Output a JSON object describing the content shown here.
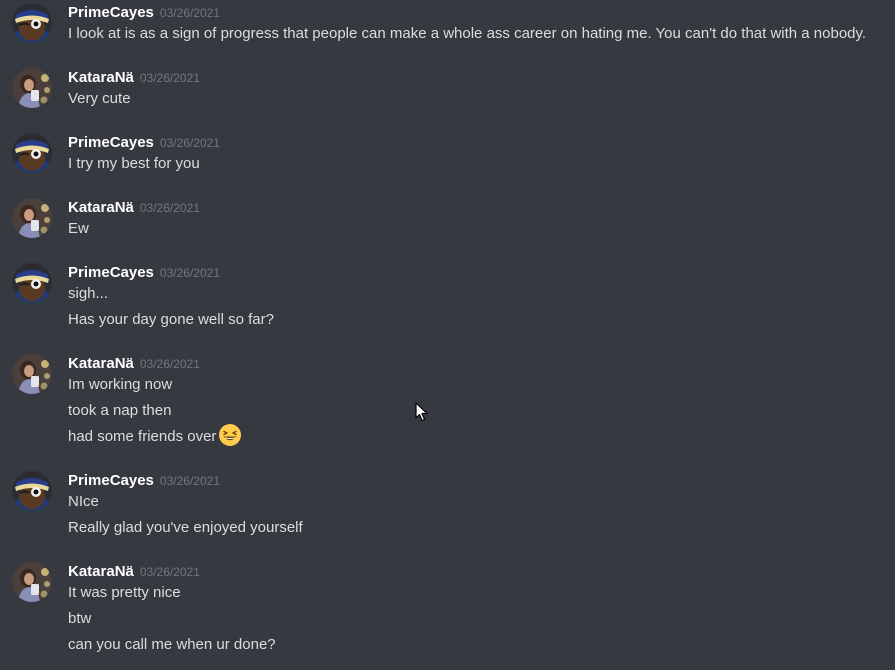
{
  "colors": {
    "background": "#36393f",
    "username": "#ffffff",
    "timestamp": "#72767d",
    "message_text": "#dcddde"
  },
  "messages": [
    {
      "author": "PrimeCayes",
      "timestamp": "03/26/2021",
      "avatar_icon": "prime-cayes-avatar-icon",
      "lines": [
        "I look at is as a sign of progress that people can make a whole ass career on hating me. You can't do that with a nobody."
      ]
    },
    {
      "author": "KataraNä",
      "timestamp": "03/26/2021",
      "avatar_icon": "katara-avatar-icon",
      "lines": [
        "Very cute"
      ]
    },
    {
      "author": "PrimeCayes",
      "timestamp": "03/26/2021",
      "avatar_icon": "prime-cayes-avatar-icon",
      "lines": [
        "I try my best for you"
      ]
    },
    {
      "author": "KataraNä",
      "timestamp": "03/26/2021",
      "avatar_icon": "katara-avatar-icon",
      "lines": [
        "Ew"
      ]
    },
    {
      "author": "PrimeCayes",
      "timestamp": "03/26/2021",
      "avatar_icon": "prime-cayes-avatar-icon",
      "lines": [
        "sigh...",
        "Has your day gone well so far?"
      ]
    },
    {
      "author": "KataraNä",
      "timestamp": "03/26/2021",
      "avatar_icon": "katara-avatar-icon",
      "lines": [
        "Im working now",
        "took a nap then",
        "had some friends over"
      ],
      "emoji": {
        "line_index": 2,
        "icon": "grinning-squinting-face-emoji"
      }
    },
    {
      "author": "PrimeCayes",
      "timestamp": "03/26/2021",
      "avatar_icon": "prime-cayes-avatar-icon",
      "lines": [
        "NIce",
        "Really glad you've enjoyed yourself"
      ]
    },
    {
      "author": "KataraNä",
      "timestamp": "03/26/2021",
      "avatar_icon": "katara-avatar-icon",
      "lines": [
        "It was pretty nice",
        "btw",
        "can you call me when ur done?"
      ]
    }
  ]
}
